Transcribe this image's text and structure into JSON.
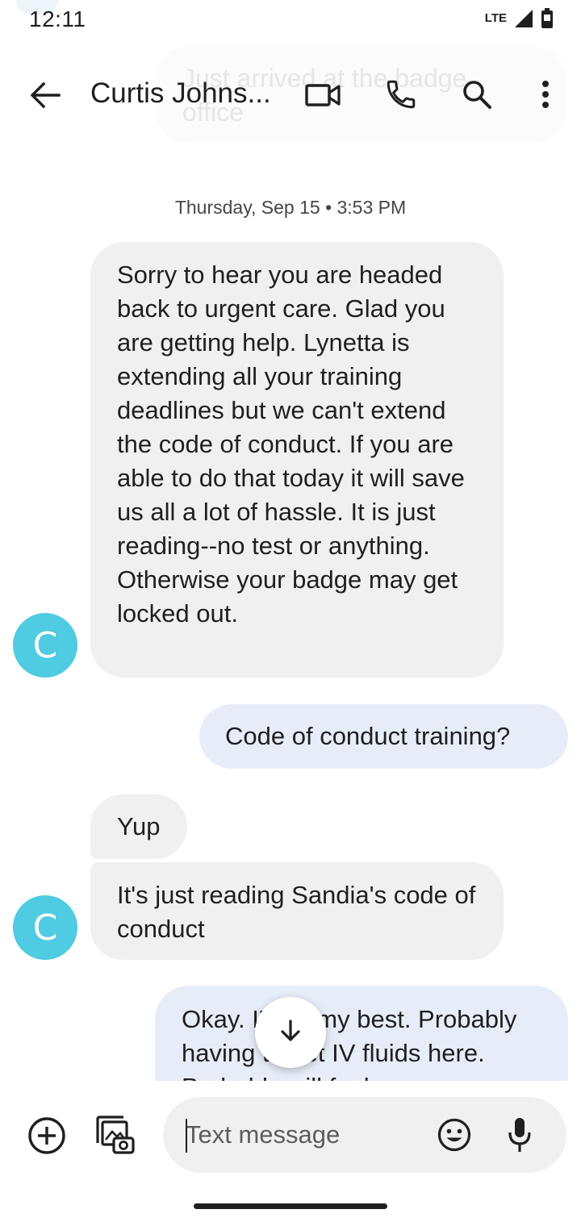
{
  "status_bar": {
    "time": "12:11",
    "network": "LTE"
  },
  "ghost_notification": {
    "text": "Just arrived at the badge office"
  },
  "header": {
    "contact_name": "Curtis Johns...",
    "icons": [
      "back-arrow-icon",
      "video-call-icon",
      "phone-icon",
      "search-icon",
      "more-vert-icon"
    ]
  },
  "conversation": {
    "date_separator": "Thursday, Sep 15 • 3:53 PM",
    "avatar_initial": "C",
    "messages": [
      {
        "direction": "incoming",
        "text": "Sorry to hear you are headed back to urgent care. Glad you are getting help. Lynetta is extending all your training deadlines but we can't extend the code of conduct. If you are able to do that today it will save us all a lot of hassle. It is just reading--no test or anything. Otherwise your badge may get locked out."
      },
      {
        "direction": "outgoing",
        "text": "Code of conduct training?"
      },
      {
        "direction": "incoming",
        "text": "Yup"
      },
      {
        "direction": "incoming",
        "text": "It's just reading Sandia's code of conduct"
      },
      {
        "direction": "outgoing",
        "text": "Okay. I'll do my best. Probably having to get IV fluids here. Probably will feel"
      }
    ]
  },
  "compose": {
    "placeholder": "Text message"
  },
  "colors": {
    "avatar": "#4fcbe2",
    "incoming_bubble": "#f0f0f0",
    "outgoing_bubble": "#e7edf8"
  }
}
